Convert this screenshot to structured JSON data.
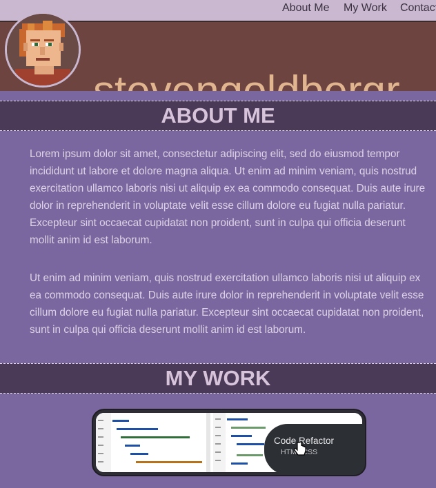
{
  "nav": {
    "items": [
      {
        "label": "About Me"
      },
      {
        "label": "My Work"
      },
      {
        "label": "Contact"
      }
    ]
  },
  "header": {
    "site_title": "stevengoldbergr"
  },
  "about": {
    "heading": "ABOUT ME",
    "paragraphs": [
      "Lorem ipsum dolor sit amet, consectetur adipiscing elit, sed do eiusmod tempor incididunt ut labore et dolore magna aliqua. Ut enim ad minim veniam, quis nostrud exercitation ullamco laboris nisi ut aliquip ex ea commodo consequat. Duis aute irure dolor in reprehenderit in voluptate velit esse cillum dolore eu fugiat nulla pariatur. Excepteur sint occaecat cupidatat non proident, sunt in culpa qui officia deserunt mollit anim id est laborum.",
      "Ut enim ad minim veniam, quis nostrud exercitation ullamco laboris nisi ut aliquip ex ea commodo consequat. Duis aute irure dolor in reprehenderit in voluptate velit esse cillum dolore eu fugiat nulla pariatur. Excepteur sint occaecat cupidatat non proident, sunt in culpa qui officia deserunt mollit anim id est laborum."
    ]
  },
  "work": {
    "heading": "MY WORK",
    "projects": [
      {
        "title": "Code Refactor",
        "subtitle": "HTML/CSS"
      }
    ]
  }
}
